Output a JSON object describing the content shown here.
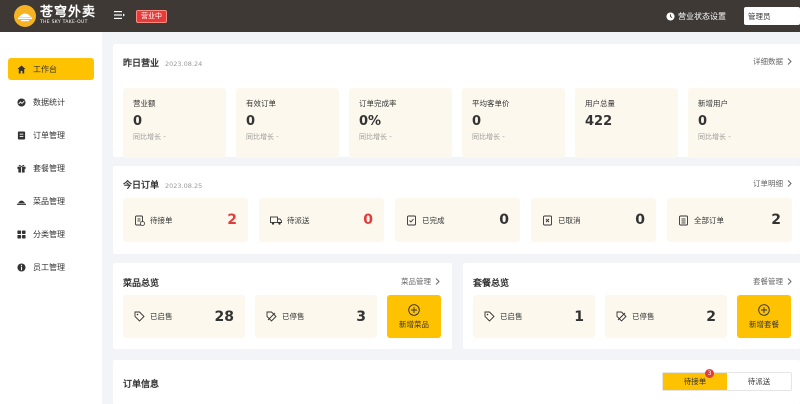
{
  "header": {
    "logo_cn": "苍穹外卖",
    "logo_en": "THE SKY TAKE-OUT",
    "status_tag": "营业中",
    "shop_setting": "营业状态设置",
    "role": "管理员"
  },
  "sidebar": {
    "items": [
      {
        "label": "工作台",
        "icon": "home-icon",
        "active": true
      },
      {
        "label": "数据统计",
        "icon": "chart-icon",
        "active": false
      },
      {
        "label": "订单管理",
        "icon": "order-icon",
        "active": false
      },
      {
        "label": "套餐管理",
        "icon": "gift-icon",
        "active": false
      },
      {
        "label": "菜品管理",
        "icon": "dish-icon",
        "active": false
      },
      {
        "label": "分类管理",
        "icon": "grid-icon",
        "active": false
      },
      {
        "label": "员工管理",
        "icon": "user-icon",
        "active": false
      }
    ]
  },
  "yesterday": {
    "title": "昨日营业",
    "date": "2023.08.24",
    "link": "详细数据",
    "metrics": [
      {
        "label": "营业额",
        "value": "0",
        "sub": "同比增长 -"
      },
      {
        "label": "有效订单",
        "value": "0",
        "sub": "同比增长 -"
      },
      {
        "label": "订单完成率",
        "value": "0%",
        "sub": "同比增长 -"
      },
      {
        "label": "平均客单价",
        "value": "0",
        "sub": "同比增长 -"
      },
      {
        "label": "用户总量",
        "value": "422",
        "sub": ""
      },
      {
        "label": "新增用户",
        "value": "0",
        "sub": "同比增长 -"
      }
    ]
  },
  "today": {
    "title": "今日订单",
    "date": "2023.08.25",
    "link": "订单明细",
    "boxes": [
      {
        "label": "待接单",
        "count": "2",
        "highlight": true
      },
      {
        "label": "待派送",
        "count": "0",
        "highlight": true
      },
      {
        "label": "已完成",
        "count": "0",
        "highlight": false
      },
      {
        "label": "已取消",
        "count": "0",
        "highlight": false
      },
      {
        "label": "全部订单",
        "count": "2",
        "highlight": false
      }
    ]
  },
  "dishes": {
    "title": "菜品总览",
    "link": "菜品管理",
    "on_sale_label": "已启售",
    "on_sale_count": "28",
    "off_sale_label": "已停售",
    "off_sale_count": "3",
    "add_label": "新增菜品"
  },
  "setmeals": {
    "title": "套餐总览",
    "link": "套餐管理",
    "on_sale_label": "已启售",
    "on_sale_count": "1",
    "off_sale_label": "已停售",
    "off_sale_count": "2",
    "add_label": "新增套餐"
  },
  "order_info": {
    "title": "订单信息",
    "tabs": [
      {
        "label": "待接单",
        "active": true,
        "badge": "3"
      },
      {
        "label": "待派送",
        "active": false
      }
    ]
  },
  "colors": {
    "accent": "#ffc200",
    "header_bg": "#3f3935",
    "alert": "#e23b3b",
    "tile_bg": "#fdf8ee"
  }
}
